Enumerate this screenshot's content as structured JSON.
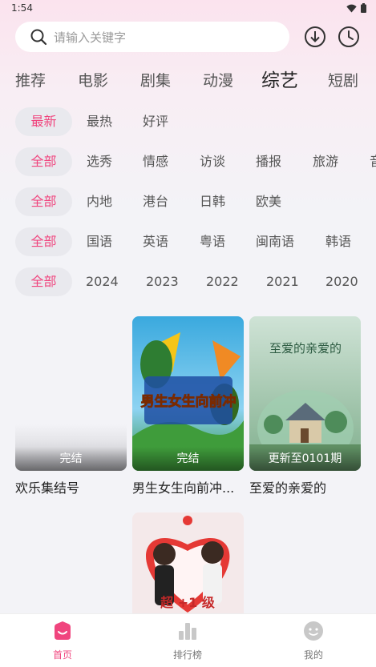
{
  "status": {
    "time": "1:54"
  },
  "search": {
    "placeholder": "请输入关键字"
  },
  "top_icons": [
    "download-icon",
    "history-icon"
  ],
  "tabs": [
    {
      "label": "推荐",
      "active": false
    },
    {
      "label": "电影",
      "active": false
    },
    {
      "label": "剧集",
      "active": false
    },
    {
      "label": "动漫",
      "active": false
    },
    {
      "label": "综艺",
      "active": true
    },
    {
      "label": "短剧",
      "active": false
    }
  ],
  "filters": {
    "sort": {
      "selected": "最新",
      "options": [
        "最热",
        "好评"
      ]
    },
    "genre": {
      "selected": "全部",
      "options": [
        "选秀",
        "情感",
        "访谈",
        "播报",
        "旅游",
        "音"
      ]
    },
    "region": {
      "selected": "全部",
      "options": [
        "内地",
        "港台",
        "日韩",
        "欧美"
      ]
    },
    "language": {
      "selected": "全部",
      "options": [
        "国语",
        "英语",
        "粤语",
        "闽南语",
        "韩语"
      ]
    },
    "year": {
      "selected": "全部",
      "options": [
        "2024",
        "2023",
        "2022",
        "2021",
        "2020"
      ]
    }
  },
  "cards": [
    {
      "title": "欢乐集结号",
      "badge": "完结"
    },
    {
      "title": "男生女生向前冲...",
      "badge": "完结",
      "poster_text": "男生女生向前冲"
    },
    {
      "title": "至爱的亲爱的",
      "badge": "更新至0101期",
      "poster_text": "至爱的亲爱的"
    },
    {
      "title": "",
      "badge": "",
      "poster_text": "超 +1 级"
    }
  ],
  "bottom_nav": [
    {
      "label": "首页",
      "icon": "home-icon",
      "active": true
    },
    {
      "label": "排行榜",
      "icon": "ranking-icon",
      "active": false
    },
    {
      "label": "我的",
      "icon": "profile-icon",
      "active": false
    }
  ],
  "colors": {
    "accent": "#f0457e",
    "chip_bg": "#e9e9ee",
    "background": "#f3f3f7"
  }
}
